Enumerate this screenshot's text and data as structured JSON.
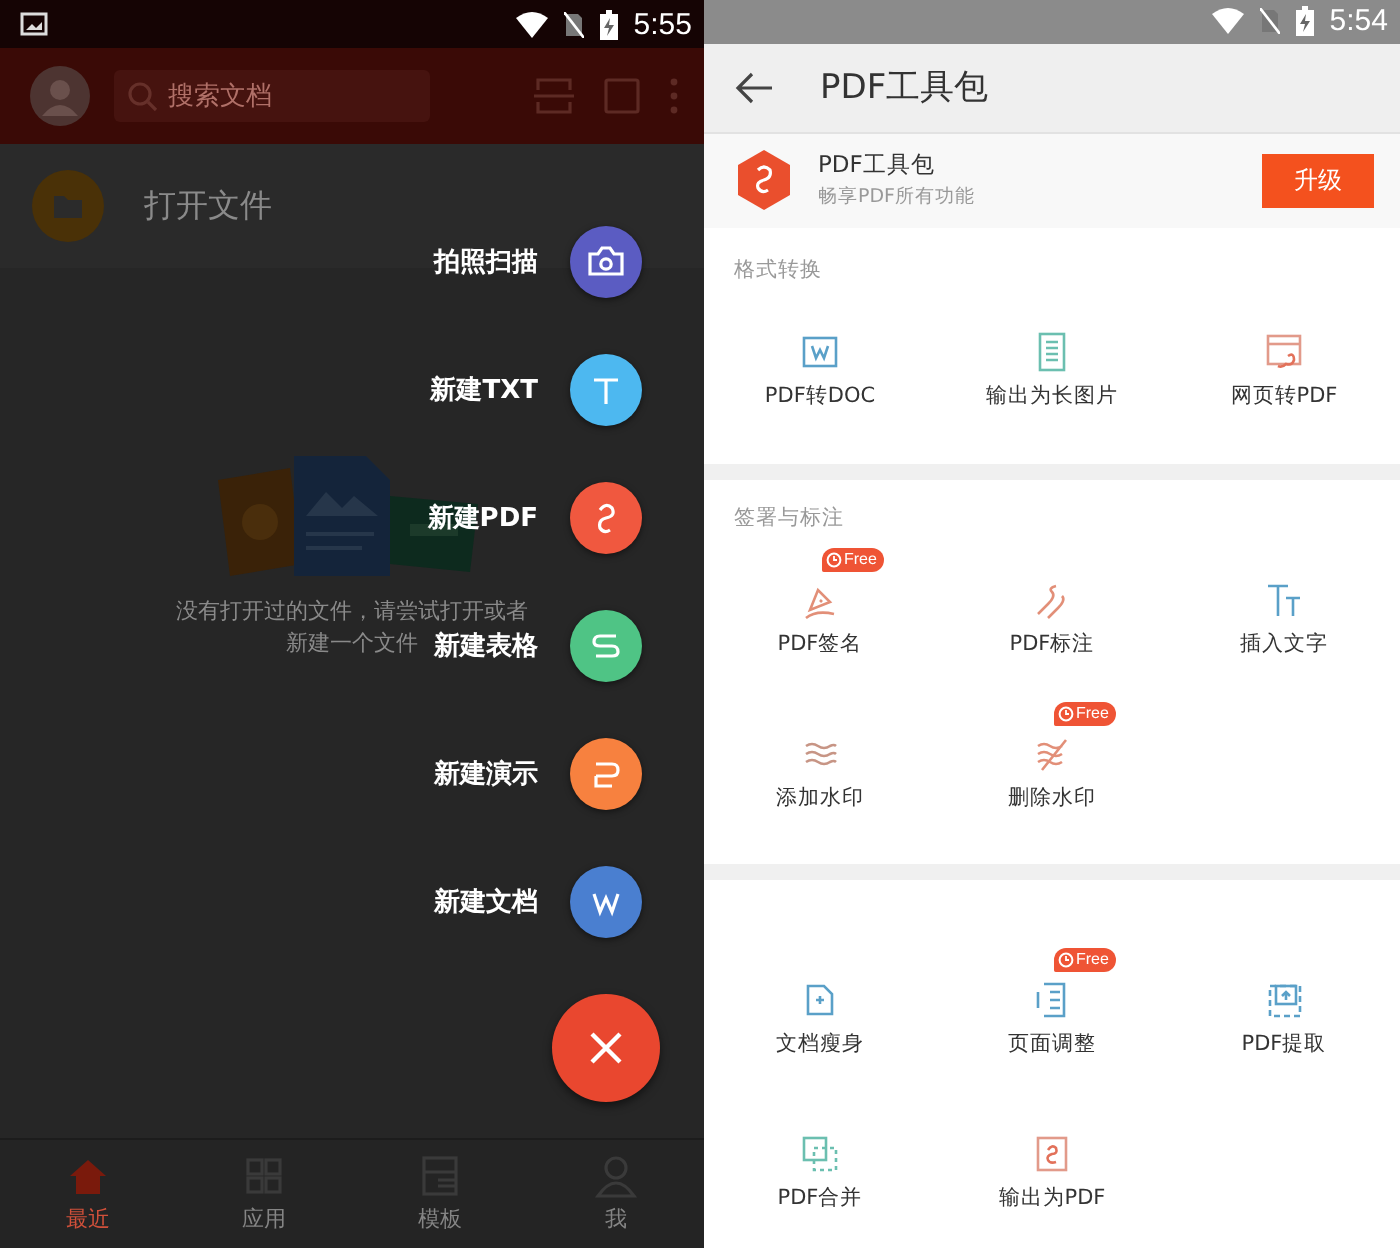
{
  "left_screen": {
    "status_bar": {
      "time": "5:55"
    },
    "header": {
      "search_placeholder": "搜索文档"
    },
    "open_file": {
      "label": "打开文件"
    },
    "empty_state": {
      "lines": [
        "没有打开过的文件，请尝试打开或者",
        "新建一个文件"
      ]
    },
    "fab_menu": [
      {
        "label": "拍照扫描",
        "kind": "camera",
        "color": "#5b5cc2"
      },
      {
        "label": "新建TXT",
        "kind": "txt",
        "color": "#4db8f0"
      },
      {
        "label": "新建PDF",
        "kind": "pdf",
        "color": "#f0583f"
      },
      {
        "label": "新建表格",
        "kind": "sheet",
        "color": "#4fc485"
      },
      {
        "label": "新建演示",
        "kind": "slides",
        "color": "#f7813f"
      },
      {
        "label": "新建文档",
        "kind": "doc",
        "color": "#4a7fd0"
      }
    ],
    "bottom_nav": [
      {
        "label": "最近",
        "kind": "home",
        "selected": true
      },
      {
        "label": "应用",
        "kind": "apps",
        "selected": false
      },
      {
        "label": "模板",
        "kind": "template",
        "selected": false
      },
      {
        "label": "我",
        "kind": "person",
        "selected": false
      }
    ]
  },
  "right_screen": {
    "status_bar": {
      "time": "5:54"
    },
    "title": "PDF工具包",
    "promo": {
      "title": "PDF工具包",
      "subtitle": "畅享PDF所有功能",
      "button": "升级"
    },
    "sections": [
      {
        "heading": "格式转换",
        "tools": [
          {
            "label": "PDF转DOC",
            "kind": "to-doc"
          },
          {
            "label": "输出为长图片",
            "kind": "long-image"
          },
          {
            "label": "网页转PDF",
            "kind": "web-pdf"
          }
        ]
      },
      {
        "heading": "签署与标注",
        "tools": [
          {
            "label": "PDF签名",
            "kind": "sign",
            "badge": "Free"
          },
          {
            "label": "PDF标注",
            "kind": "annotate"
          },
          {
            "label": "插入文字",
            "kind": "text"
          },
          {
            "label": "添加水印",
            "kind": "watermark"
          },
          {
            "label": "删除水印",
            "kind": "unwatermark",
            "badge": "Free"
          }
        ]
      },
      {
        "tools": [
          {
            "label": "文档瘦身",
            "kind": "slim"
          },
          {
            "label": "页面调整",
            "kind": "pages",
            "badge": "Free"
          },
          {
            "label": "PDF提取",
            "kind": "extract"
          },
          {
            "label": "PDF合并",
            "kind": "merge"
          },
          {
            "label": "输出为PDF",
            "kind": "export"
          }
        ]
      }
    ]
  }
}
